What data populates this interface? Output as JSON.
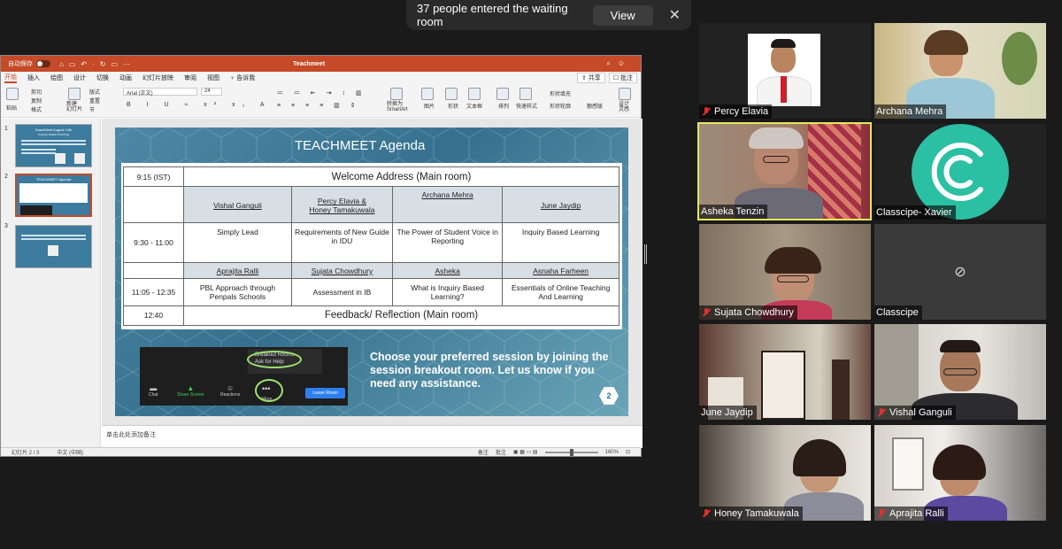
{
  "notification": {
    "message": "37 people entered the waiting room",
    "view_label": "View",
    "close_icon": "close-icon"
  },
  "ppt": {
    "autosave_label": "自动保存",
    "document_title": "Teachmeet",
    "menu": [
      "开始",
      "插入",
      "绘图",
      "设计",
      "切换",
      "动画",
      "幻灯片放映",
      "审阅",
      "视图"
    ],
    "tell_me": "告诉我",
    "share_label": "共享",
    "comment_label": "批注",
    "ribbon": {
      "paste": "粘贴",
      "cut": "剪切",
      "copy": "复制",
      "format": "格式",
      "new_slide": "新建\n幻灯片",
      "layout": "版式",
      "reset": "重置",
      "section": "节",
      "font_name": "Arial (正文)",
      "font_size": "24",
      "convert_smartart": "转换为\nSmartArt",
      "picture": "图片",
      "shape": "形状",
      "textbox": "文本框",
      "arrange": "排列",
      "quick_styles": "快速样式",
      "shape_fill": "形状填充",
      "shape_outline": "形状轮廓",
      "designer_a": "额感版",
      "designer_b": "设计\n灵感"
    },
    "notes_placeholder": "单击此处添加备注",
    "status": {
      "slide_counter": "幻灯片 2 / 3",
      "language": "中文 (中国)",
      "notes": "备注",
      "comments": "批注",
      "zoom": "160%"
    },
    "thumbnails": [
      {
        "num": "1",
        "title": "TeachMeet August 14th",
        "subtitle": "Inquiry-based learning"
      },
      {
        "num": "2",
        "title": "TEACHMEET Agenda"
      },
      {
        "num": "3"
      }
    ]
  },
  "slide": {
    "title": "TEACHMEET Agenda",
    "agenda": {
      "row1_time": "9:15 (IST)",
      "row1_event": "Welcome Address (Main room)",
      "speakers1": [
        "Vishal Ganguli",
        "Percy Elavia &\nHoney Tamakuwala",
        "Archana Mehra",
        "June Jaydip"
      ],
      "row2_time": "9:30 - 11:00",
      "topics1": [
        "Simply Lead",
        "Requirements of New Guide in IDU",
        "The Power of Student Voice in Reporting",
        "Inquiry Based Learning"
      ],
      "speakers2": [
        "Aprajita Ralli",
        "Sujata Chowdhury",
        "Asheka",
        "Asnaha Farheen"
      ],
      "row3_time": "11:05 - 12:35",
      "topics2": [
        "PBL Approach through Penpals Schools",
        "Assessment in IB",
        "What is Inquiry Based Learning?",
        "Essentials of Online Teaching And Learning"
      ],
      "row4_time": "12:40",
      "row4_event": "Feedback/ Reflection (Main room)"
    },
    "zoom_menu": [
      "Breakout Rooms",
      "Ask for Help"
    ],
    "zoom_controls": [
      "Chat",
      "Share Screen",
      "Reactions",
      "More"
    ],
    "zoom_leave": "Leave Room",
    "cta": "Choose your preferred session by joining the session breakout room. Let us know if you need any assistance.",
    "page_number": "2"
  },
  "participants": [
    {
      "name": "Percy Elavia",
      "muted": true
    },
    {
      "name": "Archana Mehra",
      "muted": false
    },
    {
      "name": "Asheka Tenzin",
      "muted": false,
      "speaking": true
    },
    {
      "name": "Classcipe- Xavier",
      "muted": false
    },
    {
      "name": "Sujata Chowdhury",
      "muted": true
    },
    {
      "name": "Classcipe",
      "muted": false,
      "camera_off": true
    },
    {
      "name": "June Jaydip",
      "muted": false
    },
    {
      "name": "Vishal Ganguli",
      "muted": true
    },
    {
      "name": "Honey Tamakuwala",
      "muted": true
    },
    {
      "name": "Aprajita Ralli",
      "muted": true
    }
  ],
  "colors": {
    "ppt_accent": "#c44a28",
    "speaking_border": "#e6e85a",
    "mute_red": "#e0302e",
    "highlight_green": "#9de26f",
    "classcipe_teal": "#2bbfa3"
  }
}
